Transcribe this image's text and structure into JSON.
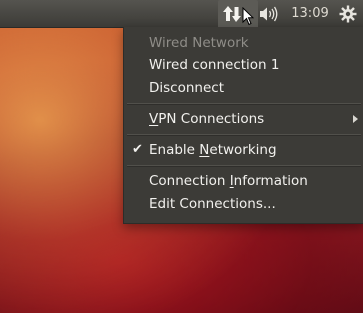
{
  "panel": {
    "clock": "13:09",
    "icons": [
      "network-icon",
      "mouse-cursor-icon",
      "volume-icon",
      "gear-icon"
    ]
  },
  "network_menu": {
    "items": [
      {
        "label": "Wired Network",
        "enabled": false
      },
      {
        "label": "Wired connection 1",
        "enabled": true
      },
      {
        "label": "Disconnect",
        "enabled": true
      },
      {
        "label_pre": "",
        "label_ul": "V",
        "label_post": "PN Connections",
        "has_submenu": true
      },
      {
        "label_pre": "Enable ",
        "label_ul": "N",
        "label_post": "etworking",
        "checked": true
      },
      {
        "label_pre": "Connection ",
        "label_ul": "I",
        "label_post": "nformation"
      },
      {
        "label_pre": "Edit Connections",
        "label_ul": "",
        "label_post": "..."
      }
    ]
  },
  "colors": {
    "panel_bg": "#3c3b37",
    "menu_bg": "#3c3b37",
    "text": "#f2f1ee",
    "disabled_text": "#8f8d88"
  }
}
